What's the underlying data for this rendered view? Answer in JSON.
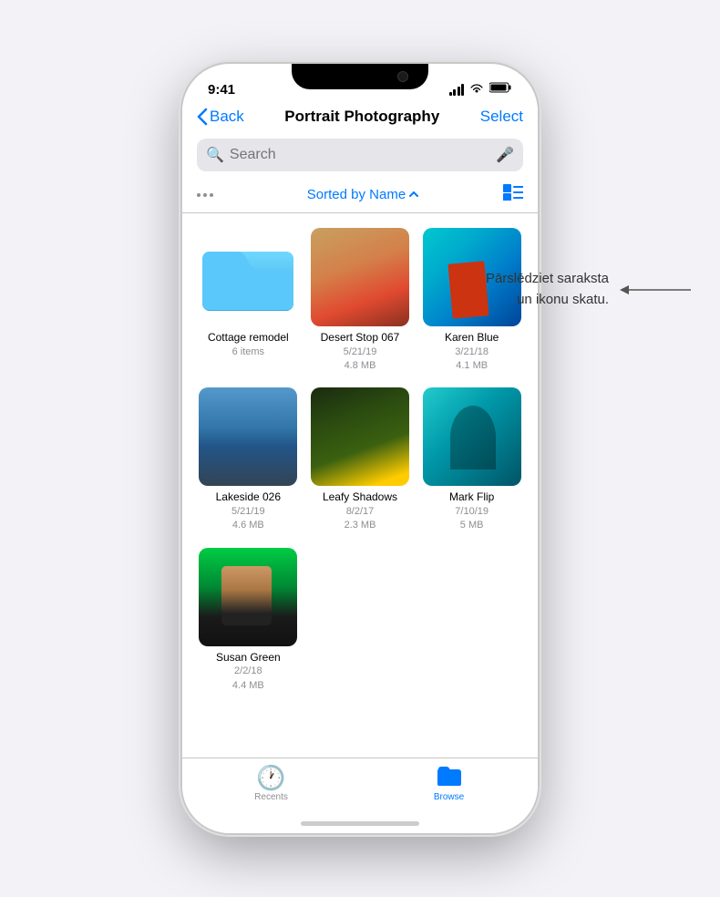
{
  "statusBar": {
    "time": "9:41",
    "battery": "🔋"
  },
  "nav": {
    "back": "Back",
    "title": "Portrait Photography",
    "select": "Select"
  },
  "search": {
    "placeholder": "Search"
  },
  "sortBar": {
    "sortLabel": "Sorted by Name",
    "chevron": "^"
  },
  "annotation": {
    "line1": "Pārslēdziet saraksta",
    "line2": "un ikonu skatu."
  },
  "items": [
    {
      "name": "Cottage remodel",
      "meta1": "6 items",
      "meta2": "",
      "type": "folder"
    },
    {
      "name": "Desert Stop 067",
      "meta1": "5/21/19",
      "meta2": "4.8 MB",
      "type": "desert"
    },
    {
      "name": "Karen Blue",
      "meta1": "3/21/18",
      "meta2": "4.1 MB",
      "type": "karen"
    },
    {
      "name": "Lakeside 026",
      "meta1": "5/21/19",
      "meta2": "4.6 MB",
      "type": "lakeside"
    },
    {
      "name": "Leafy Shadows",
      "meta1": "8/2/17",
      "meta2": "2.3 MB",
      "type": "leafy"
    },
    {
      "name": "Mark Flip",
      "meta1": "7/10/19",
      "meta2": "5 MB",
      "type": "mark"
    },
    {
      "name": "Susan Green",
      "meta1": "2/2/18",
      "meta2": "4.4 MB",
      "type": "susan"
    }
  ],
  "tabs": [
    {
      "label": "Recents",
      "active": false
    },
    {
      "label": "Browse",
      "active": true
    }
  ]
}
